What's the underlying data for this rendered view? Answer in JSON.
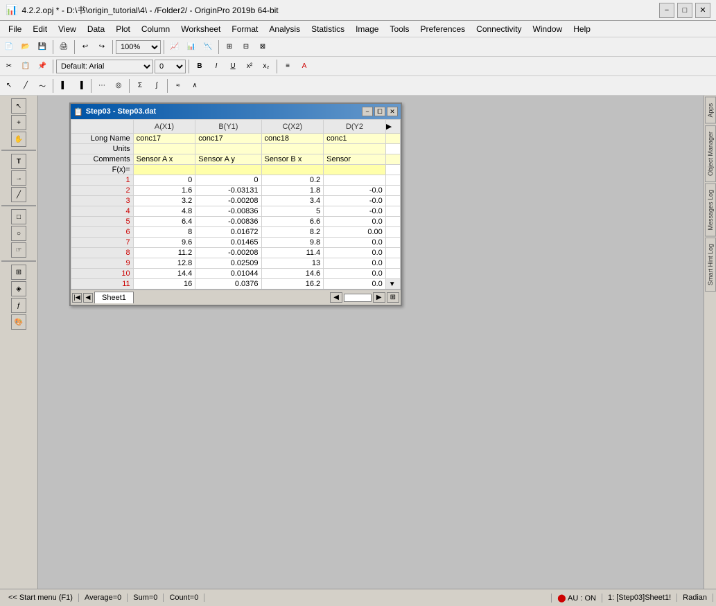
{
  "titlebar": {
    "title": "4.2.2.opj * - D:\\书\\origin_tutorial\\4\\ - /Folder2/ - OriginPro 2019b 64-bit",
    "icon": "📊",
    "min_label": "−",
    "max_label": "□",
    "close_label": "✕"
  },
  "menu": {
    "items": [
      "File",
      "Edit",
      "View",
      "Data",
      "Plot",
      "Column",
      "Worksheet",
      "Format",
      "Analysis",
      "Statistics",
      "Image",
      "Tools",
      "Preferences",
      "Connectivity",
      "Window",
      "Help"
    ]
  },
  "toolbar1": {
    "zoom_value": "100%",
    "font_name": "Default: Arial",
    "font_size": "0"
  },
  "mdi_window": {
    "title": "Step03 - Step03.dat",
    "icon": "📋",
    "min": "−",
    "restore": "⧠",
    "close": "✕"
  },
  "spreadsheet": {
    "columns": [
      "A(X1)",
      "B(Y1)",
      "C(X2)",
      "D(Y2"
    ],
    "row_labels": [
      "Long Name",
      "Units",
      "Comments",
      "F(x)="
    ],
    "long_name": [
      "conc17",
      "conc17",
      "conc18",
      "conc1"
    ],
    "comments": [
      "Sensor A x",
      "Sensor A y",
      "Sensor B x",
      "Sensor"
    ],
    "rows": [
      {
        "num": 1,
        "ax": "0",
        "by": "0",
        "cx": "0.2",
        "dy": ""
      },
      {
        "num": 2,
        "ax": "1.6",
        "by": "-0.03131",
        "cx": "1.8",
        "dy": "-0.0"
      },
      {
        "num": 3,
        "ax": "3.2",
        "by": "-0.00208",
        "cx": "3.4",
        "dy": "-0.0"
      },
      {
        "num": 4,
        "ax": "4.8",
        "by": "-0.00836",
        "cx": "5",
        "dy": "-0.0"
      },
      {
        "num": 5,
        "ax": "6.4",
        "by": "-0.00836",
        "cx": "6.6",
        "dy": "0.0"
      },
      {
        "num": 6,
        "ax": "8",
        "by": "0.01672",
        "cx": "8.2",
        "dy": "0.00"
      },
      {
        "num": 7,
        "ax": "9.6",
        "by": "0.01465",
        "cx": "9.8",
        "dy": "0.0"
      },
      {
        "num": 8,
        "ax": "11.2",
        "by": "-0.00208",
        "cx": "11.4",
        "dy": "0.0"
      },
      {
        "num": 9,
        "ax": "12.8",
        "by": "0.02509",
        "cx": "13",
        "dy": "0.0"
      },
      {
        "num": 10,
        "ax": "14.4",
        "by": "0.01044",
        "cx": "14.6",
        "dy": "0.0"
      },
      {
        "num": 11,
        "ax": "16",
        "by": "0.0376",
        "cx": "16.2",
        "dy": "0.0"
      }
    ]
  },
  "sheet_tab": "Sheet1",
  "status": {
    "average": "Average=0",
    "sum": "Sum=0",
    "count": "Count=0",
    "au": "AU : ON",
    "sheet_info": "1: [Step03]Sheet1!",
    "radian": "Radian"
  },
  "right_panels": {
    "apps_label": "Apps",
    "object_manager": "Object Manager",
    "messages_log": "Messages Log",
    "smart_hint": "Smart Hint Log"
  },
  "start_menu": "<< Start menu (F1)"
}
